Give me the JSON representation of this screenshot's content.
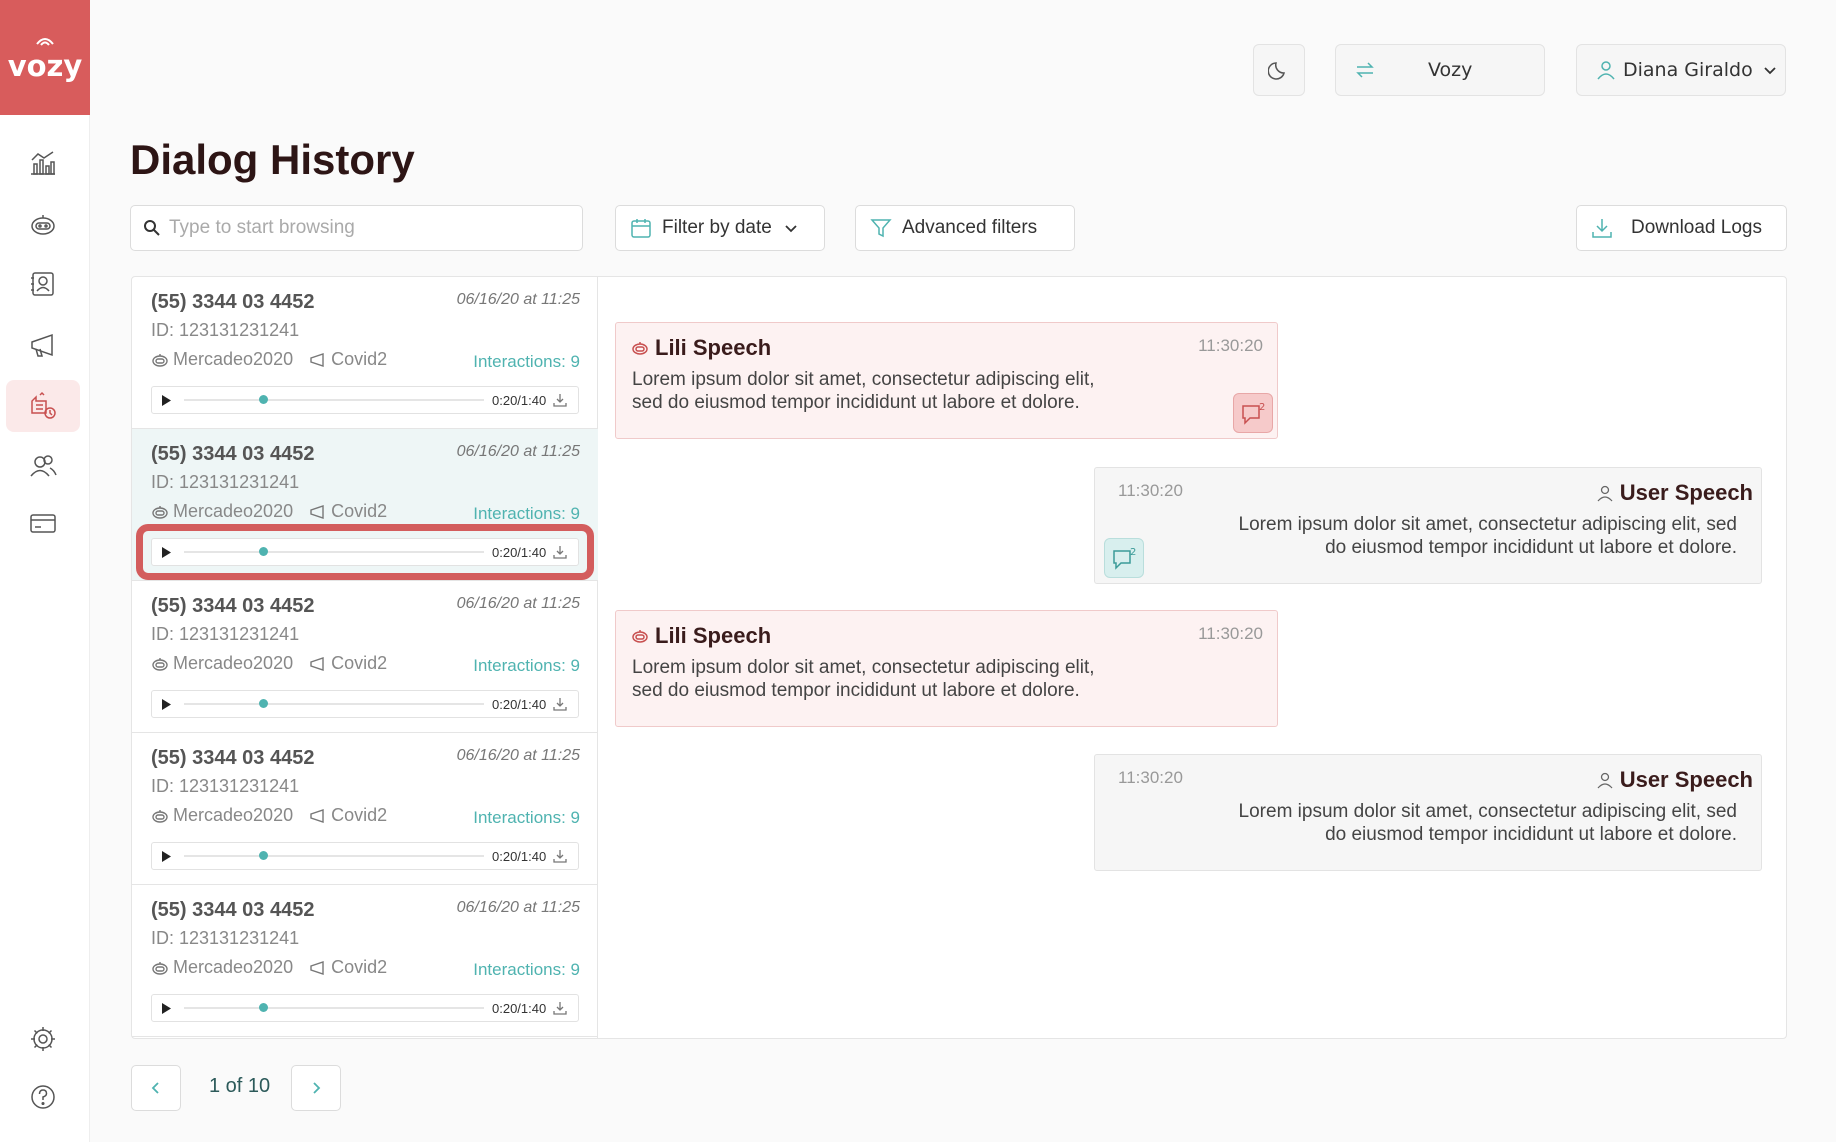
{
  "brand": {
    "logo_text": "vozy",
    "accent": "#d85c5c",
    "teal": "#4fb3b0"
  },
  "sidebar": {
    "items": [
      {
        "icon": "analytics-icon",
        "active": false
      },
      {
        "icon": "bot-icon",
        "active": false
      },
      {
        "icon": "contacts-icon",
        "active": false
      },
      {
        "icon": "megaphone-icon",
        "active": false
      },
      {
        "icon": "dialog-history-icon",
        "active": true
      },
      {
        "icon": "users-icon",
        "active": false
      },
      {
        "icon": "billing-card-icon",
        "active": false
      }
    ],
    "bottom": [
      {
        "icon": "settings-gear-icon"
      },
      {
        "icon": "help-icon"
      }
    ]
  },
  "header": {
    "theme_icon": "moon-icon",
    "workspace_label": "Vozy",
    "user_name": "Diana Giraldo"
  },
  "page": {
    "title": "Dialog History"
  },
  "toolbar": {
    "search_placeholder": "Type to start browsing",
    "filter_date_label": "Filter by date",
    "advanced_filters_label": "Advanced filters",
    "download_logs_label": "Download Logs"
  },
  "calls": [
    {
      "phone": "(55) 3344 03 4452",
      "date": "06/16/20 at 11:25",
      "id": "ID: 123131231241",
      "bot": "Mercadeo2020",
      "campaign": "Covid2",
      "interactions": "Interactions: 9",
      "time": "0:20/1:40",
      "progress": 0.15,
      "selected": false
    },
    {
      "phone": "(55) 3344 03 4452",
      "date": "06/16/20 at 11:25",
      "id": "ID: 123131231241",
      "bot": "Mercadeo2020",
      "campaign": "Covid2",
      "interactions": "Interactions: 9",
      "time": "0:20/1:40",
      "progress": 0.15,
      "selected": true
    },
    {
      "phone": "(55) 3344 03 4452",
      "date": "06/16/20 at 11:25",
      "id": "ID: 123131231241",
      "bot": "Mercadeo2020",
      "campaign": "Covid2",
      "interactions": "Interactions: 9",
      "time": "0:20/1:40",
      "progress": 0.15,
      "selected": false
    },
    {
      "phone": "(55) 3344 03 4452",
      "date": "06/16/20 at 11:25",
      "id": "ID: 123131231241",
      "bot": "Mercadeo2020",
      "campaign": "Covid2",
      "interactions": "Interactions: 9",
      "time": "0:20/1:40",
      "progress": 0.15,
      "selected": false
    },
    {
      "phone": "(55) 3344 03 4452",
      "date": "06/16/20 at 11:25",
      "id": "ID: 123131231241",
      "bot": "Mercadeo2020",
      "campaign": "Covid2",
      "interactions": "Interactions: 9",
      "time": "0:20/1:40",
      "progress": 0.15,
      "selected": false
    }
  ],
  "messages": [
    {
      "speaker": "Lili Speech",
      "time": "11:30:20",
      "line1": "Lorem ipsum dolor sit amet, consectetur adipiscing elit,",
      "line2": "sed do eiusmod tempor incididunt ut labore et dolore.",
      "badge_count": "2"
    },
    {
      "speaker": "User Speech",
      "time": "11:30:20",
      "line1": "Lorem ipsum dolor sit amet, consectetur adipiscing elit, sed",
      "line2": "do eiusmod tempor incididunt ut labore et dolore.",
      "badge_count": "2"
    },
    {
      "speaker": "Lili Speech",
      "time": "11:30:20",
      "line1": "Lorem ipsum dolor sit amet, consectetur adipiscing elit,",
      "line2": "sed do eiusmod tempor incididunt ut labore et dolore."
    },
    {
      "speaker": "User Speech",
      "time": "11:30:20",
      "line1": "Lorem ipsum dolor sit amet, consectetur adipiscing elit, sed",
      "line2": "do eiusmod tempor incididunt ut labore et dolore."
    }
  ],
  "pagination": {
    "label": "1 of 10"
  }
}
